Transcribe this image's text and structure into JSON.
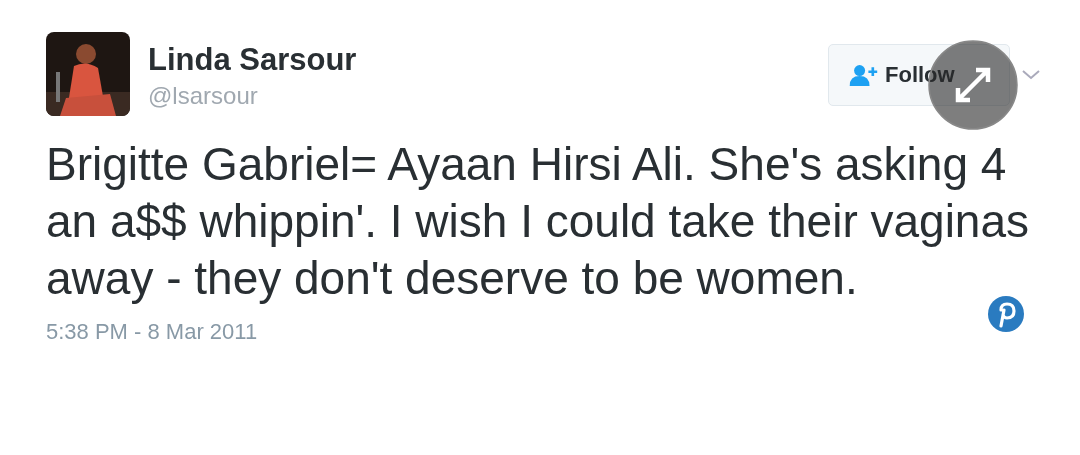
{
  "author": {
    "name": "Linda Sarsour",
    "handle": "@lsarsour"
  },
  "follow_button": {
    "label": "Follow"
  },
  "tweet": {
    "text": "Brigitte Gabriel= Ayaan Hirsi Ali. She's asking 4 an a$$ whippin'. I wish I could take their vaginas away - they don't deserve to be women.",
    "timestamp": "5:38 PM - 8 Mar 2011"
  }
}
